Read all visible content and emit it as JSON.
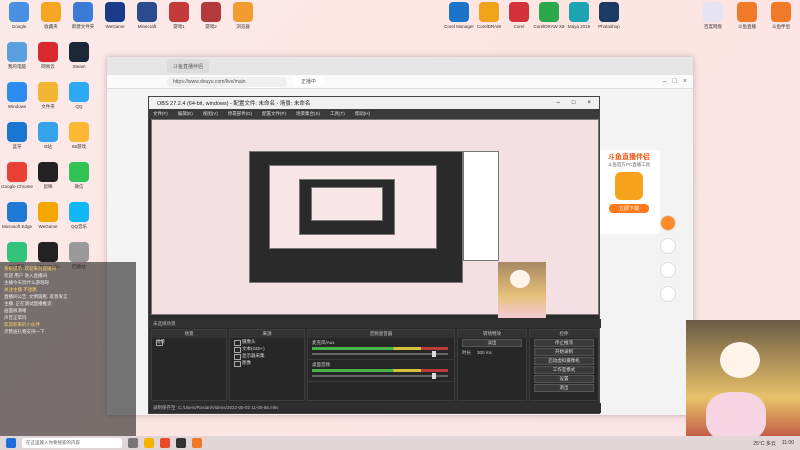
{
  "desktop_icons_top": [
    {
      "label": "Google",
      "color": "#4a90e2"
    },
    {
      "label": "收藏夹",
      "color": "#f5a623"
    },
    {
      "label": "新建文件夹",
      "color": "#3a7bd5"
    },
    {
      "label": "WeGame",
      "color": "#1a3a8a"
    },
    {
      "label": "Minecraft",
      "color": "#2a4b8d"
    },
    {
      "label": "游戏1",
      "color": "#c23a3a"
    },
    {
      "label": "游戏2",
      "color": "#b23a3a"
    },
    {
      "label": "浏览器",
      "color": "#f29b30"
    }
  ],
  "desktop_icons_right": [
    {
      "label": "Corel Manager",
      "color": "#1a74c9"
    },
    {
      "label": "CorelDRAW",
      "color": "#f0a21b"
    },
    {
      "label": "Corel",
      "color": "#d4323a"
    },
    {
      "label": "CorelDRAW X8",
      "color": "#2aa84a"
    },
    {
      "label": "Maya 2019",
      "color": "#1ea3b2"
    },
    {
      "label": "Photoshop",
      "color": "#1b3a64"
    },
    {
      "label": "百度网盘",
      "color": "#e4e4f4"
    },
    {
      "label": "斗鱼直播",
      "color": "#f07a2a"
    },
    {
      "label": "斗鱼伴侣",
      "color": "#f07a2a"
    }
  ],
  "desktop_icons_left": [
    {
      "label": "我的电脑",
      "color": "#5aa0e0"
    },
    {
      "label": "网易云",
      "color": "#d8282e"
    },
    {
      "label": "Steam",
      "color": "#1b2838"
    },
    {
      "label": "Windows",
      "color": "#2d8cf0"
    },
    {
      "label": "文件夹",
      "color": "#f2b632"
    },
    {
      "label": "QQ",
      "color": "#2da8f2"
    },
    {
      "label": "蓝牙",
      "color": "#1976d2"
    },
    {
      "label": "B站",
      "color": "#36a2eb"
    },
    {
      "label": "66游戏",
      "color": "#ffb833"
    },
    {
      "label": "Google Chrome",
      "color": "#e94234"
    },
    {
      "label": "剪映",
      "color": "#222"
    },
    {
      "label": "微信",
      "color": "#30c354"
    },
    {
      "label": "Microsoft Edge",
      "color": "#1f7ad6"
    },
    {
      "label": "WeGame",
      "color": "#f6a400"
    },
    {
      "label": "QQ音乐",
      "color": "#12b7f5"
    },
    {
      "label": "QQ音乐",
      "color": "#31c27c"
    },
    {
      "label": "OBS Studio",
      "color": "#222"
    },
    {
      "label": "回收站",
      "color": "#999"
    }
  ],
  "browser": {
    "tab1": "斗鱼直播伴侣",
    "address": "https://www.douyu.com/live/main",
    "tab2": "正播中"
  },
  "obs": {
    "title": "OBS 27.2.4 (64-bit, windows) - 配置文件: 未命名 - 场景: 未命名",
    "menu": [
      "文件(F)",
      "编辑(E)",
      "视图(V)",
      "停靠部件(D)",
      "配置文件(P)",
      "场景集合(S)",
      "工具(T)",
      "帮助(H)"
    ],
    "scenes_bar": "未选择场景",
    "docks": {
      "scenes": "场景",
      "scene_item": "场景",
      "sources": "来源",
      "sources_list": [
        "摄像头",
        "文本(GDI+)",
        "显示器采集",
        "图像"
      ],
      "mixer": "音频混音器",
      "mixer_rows": [
        "麦克风/Aux",
        "桌面音频"
      ],
      "transitions": "转场特效",
      "transition_item": "淡出",
      "duration_label": "时长",
      "duration_value": "300 ms",
      "controls": "控件",
      "control_buttons": [
        "停止推流",
        "开始录制",
        "启动虚拟摄像机",
        "工作室模式",
        "设置",
        "退出"
      ]
    },
    "status": "录制保存至: C:/Users/Roxian/Videos/2022-05-02 11-00-56.mkv"
  },
  "ad": {
    "title": "斗鱼直播伴侣",
    "subtitle": "斗鱼官方PC直播工具",
    "button": "立即下载"
  },
  "chat": [
    {
      "text": "系统提示: 欢迎来到直播间",
      "hl": true
    },
    {
      "text": "欢迎 用户 进入直播间",
      "hl": false
    },
    {
      "text": "主播今天玩什么游戏呀",
      "hl": false
    },
    {
      "text": "关注主播 不迷路",
      "hl": true
    },
    {
      "text": "直播间公告: 文明观看, 友善发言",
      "hl": false
    },
    {
      "text": "主播: 正在测试直播推流",
      "hl": false
    },
    {
      "text": "画面很清晰",
      "hl": false
    },
    {
      "text": "声音正常吗",
      "hl": false
    },
    {
      "text": "欢迎新来的小伙伴",
      "hl": true
    },
    {
      "text": "点赞送礼物支持一下",
      "hl": false
    }
  ],
  "taskbar": {
    "search": "在这里输入你要搜索的内容",
    "weather": "25°C 多云",
    "time": "11:00"
  }
}
